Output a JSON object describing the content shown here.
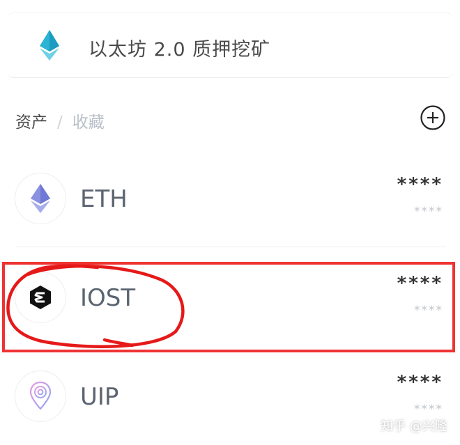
{
  "banner": {
    "text": "以太坊 2.0 质押挖矿",
    "icon": "ethereum-icon"
  },
  "tabs": {
    "active": "资产",
    "separator": "/",
    "inactive": "收藏"
  },
  "add_button": {
    "icon": "plus-circle-icon"
  },
  "assets": [
    {
      "name": "ETH",
      "balance": "****",
      "value": "****",
      "icon": "ethereum-icon"
    },
    {
      "name": "IOST",
      "balance": "****",
      "value": "****",
      "icon": "iost-icon"
    },
    {
      "name": "UIP",
      "balance": "****",
      "value": "****",
      "icon": "uip-icon"
    }
  ],
  "annotation": {
    "color": "#e33333"
  },
  "watermark": "知乎 @兴隆"
}
